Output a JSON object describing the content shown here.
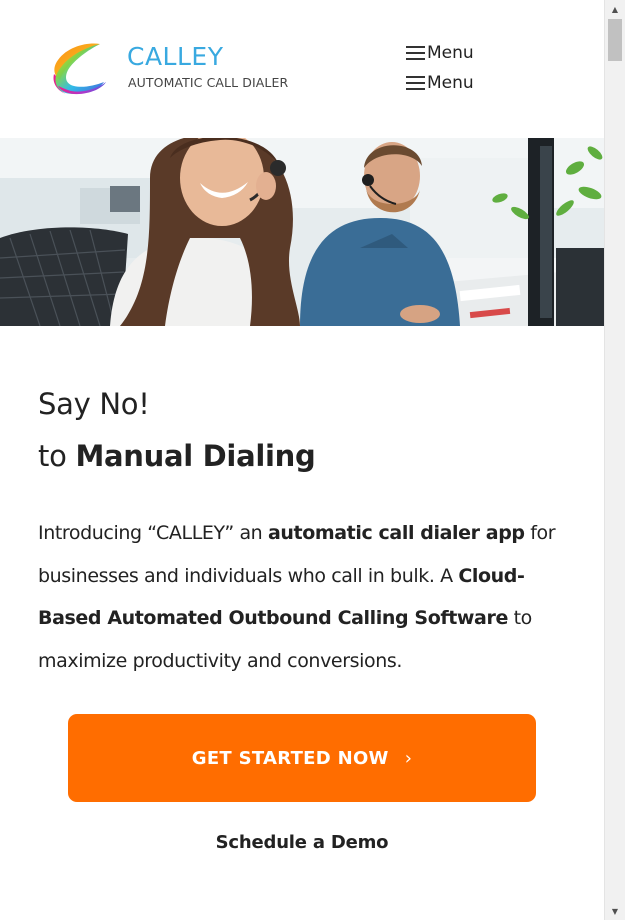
{
  "brand": {
    "name": "CALLEY",
    "tagline": "AUTOMATIC CALL DIALER",
    "name_color": "#39a9e0"
  },
  "nav": {
    "menu_label_1": "Menu",
    "menu_label_2": "Menu"
  },
  "hero": {
    "image": "call-center-agents-photo"
  },
  "headline": {
    "line1": "Say No!",
    "line2_prefix": "to ",
    "line2_bold": "Manual Dialing"
  },
  "intro": {
    "part1": "Introducing “CALLEY” an ",
    "bold1": "automatic call dialer app",
    "part2": " for businesses and individuals who call in bulk. A ",
    "bold2": "Cloud-Based Automated Outbound Calling Software",
    "part3": " to maximize productivity and conversions."
  },
  "cta": {
    "label": "GET STARTED NOW",
    "chevron": "›",
    "color": "#ff6d00"
  },
  "demo": {
    "label": "Schedule a Demo"
  },
  "scrollbar": {
    "up_arrow": "▲",
    "down_arrow": "▼"
  }
}
